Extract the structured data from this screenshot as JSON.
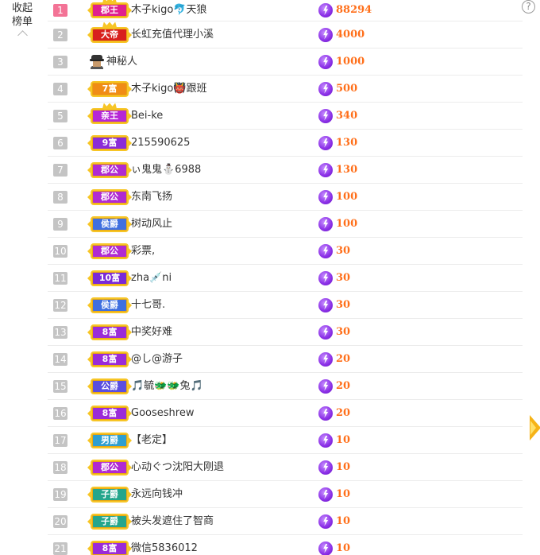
{
  "collapse": {
    "line1": "收起",
    "line2": "榜单"
  },
  "help": {
    "label": "?"
  },
  "rows": [
    {
      "rank": "1",
      "badge": "郡王",
      "badge_color": "#e0208e",
      "crown": true,
      "name": "木子kigo🐬天狼",
      "value": "88294"
    },
    {
      "rank": "2",
      "badge": "大帝",
      "badge_color": "#d8201e",
      "crown": true,
      "name": "长虹充值代理小溪",
      "value": "4000"
    },
    {
      "rank": "3",
      "badge": "",
      "badge_color": "",
      "crown": false,
      "mystery": true,
      "name": "神秘人",
      "value": "1000"
    },
    {
      "rank": "4",
      "badge": "7富",
      "badge_color": "#f08c16",
      "crown": false,
      "name": "木子kigo👹跟班",
      "value": "500"
    },
    {
      "rank": "5",
      "badge": "亲王",
      "badge_color": "#b627d6",
      "crown": true,
      "name": "Bei-ke",
      "value": "340"
    },
    {
      "rank": "6",
      "badge": "9富",
      "badge_color": "#8a2bd8",
      "crown": false,
      "name": "215590625",
      "value": "130"
    },
    {
      "rank": "7",
      "badge": "郡公",
      "badge_color": "#b02ad2",
      "crown": false,
      "name": "ぃ鬼鬼⛄6988",
      "value": "130"
    },
    {
      "rank": "8",
      "badge": "郡公",
      "badge_color": "#b02ad2",
      "crown": false,
      "name": "东南飞扬",
      "value": "100"
    },
    {
      "rank": "9",
      "badge": "侯爵",
      "badge_color": "#3f6fe0",
      "crown": false,
      "name": "树动风止",
      "value": "100"
    },
    {
      "rank": "10",
      "badge": "郡公",
      "badge_color": "#b02ad2",
      "crown": false,
      "name": "彩票,",
      "value": "30"
    },
    {
      "rank": "11",
      "badge": "10富",
      "badge_color": "#7a2ad8",
      "crown": false,
      "name": "zha💉ni",
      "value": "30"
    },
    {
      "rank": "12",
      "badge": "侯爵",
      "badge_color": "#3f6fe0",
      "crown": false,
      "name": "十七哥.",
      "value": "30"
    },
    {
      "rank": "13",
      "badge": "8富",
      "badge_color": "#9a2bd8",
      "crown": false,
      "name": "中奖好难",
      "value": "30"
    },
    {
      "rank": "14",
      "badge": "8富",
      "badge_color": "#9a2bd8",
      "crown": false,
      "name": "@し@游子",
      "value": "20"
    },
    {
      "rank": "15",
      "badge": "公爵",
      "badge_color": "#5a4ee0",
      "crown": false,
      "name": "🎵毓🐲🐲兔🎵",
      "value": "20"
    },
    {
      "rank": "16",
      "badge": "8富",
      "badge_color": "#9a2bd8",
      "crown": false,
      "name": "Gooseshrew",
      "value": "20"
    },
    {
      "rank": "17",
      "badge": "男爵",
      "badge_color": "#2f9fd0",
      "crown": false,
      "name": "【老定】",
      "value": "10"
    },
    {
      "rank": "18",
      "badge": "郡公",
      "badge_color": "#b02ad2",
      "crown": false,
      "name": "心动ぐつ沈阳大刚退",
      "value": "10"
    },
    {
      "rank": "19",
      "badge": "子爵",
      "badge_color": "#25a68c",
      "crown": false,
      "name": "永远向钱冲",
      "value": "10"
    },
    {
      "rank": "20",
      "badge": "子爵",
      "badge_color": "#25a68c",
      "crown": false,
      "name": "被头发遮住了智商",
      "value": "10"
    },
    {
      "rank": "21",
      "badge": "8富",
      "badge_color": "#9a2bd8",
      "crown": false,
      "name": "微信5836012",
      "value": "10"
    }
  ]
}
